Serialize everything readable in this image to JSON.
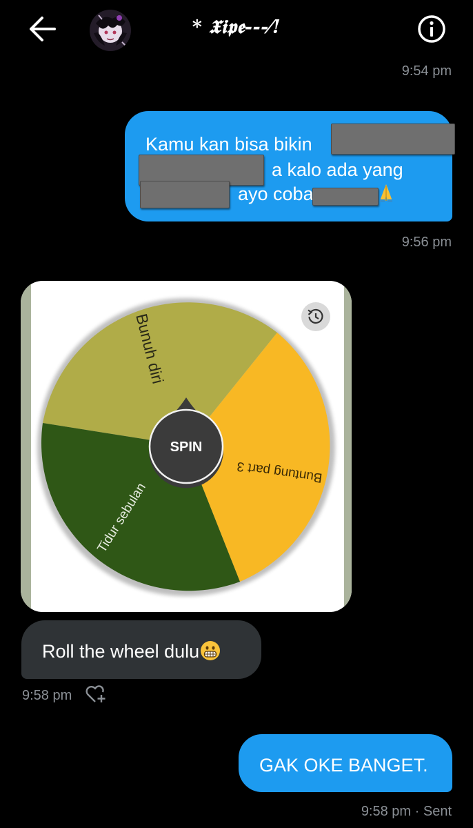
{
  "header": {
    "title": "* 𝖃𝖎𝖕𝖊---⁄!",
    "back_icon": "arrow-left-icon",
    "info_icon": "info-circle-icon"
  },
  "messages": [
    {
      "id": "t1",
      "timestamp": "9:54 pm"
    },
    {
      "id": "m1",
      "direction": "sent",
      "lines": [
        "Kamu kan bisa bikin",
        "a kalo ada yang",
        "ayo coba"
      ],
      "emoji": "folded-hands",
      "timestamp": "9:56 pm",
      "redacted": true
    },
    {
      "id": "m2",
      "direction": "received",
      "wheel": {
        "center_label": "SPIN",
        "segments": [
          {
            "label": "Bunuh diri",
            "color": "#b0ac48"
          },
          {
            "label": "Buntung part 3",
            "color": "#f8b824"
          },
          {
            "label": "Tidur sebulan",
            "color": "#2f5716"
          }
        ],
        "history_icon": "history-icon"
      }
    },
    {
      "id": "m3",
      "direction": "received",
      "text": "Roll the wheel dulu",
      "emoji": "grinning-face",
      "timestamp": "9:58 pm",
      "reaction_icon": "heart-plus-icon"
    },
    {
      "id": "m4",
      "direction": "sent",
      "text": "GAK OKE BANGET.",
      "timestamp": "9:58 pm · Sent"
    }
  ],
  "colors": {
    "background": "#000000",
    "sent_bubble": "#1d9bf0",
    "received_bubble": "#2f3336",
    "timestamp": "#8b9096"
  }
}
